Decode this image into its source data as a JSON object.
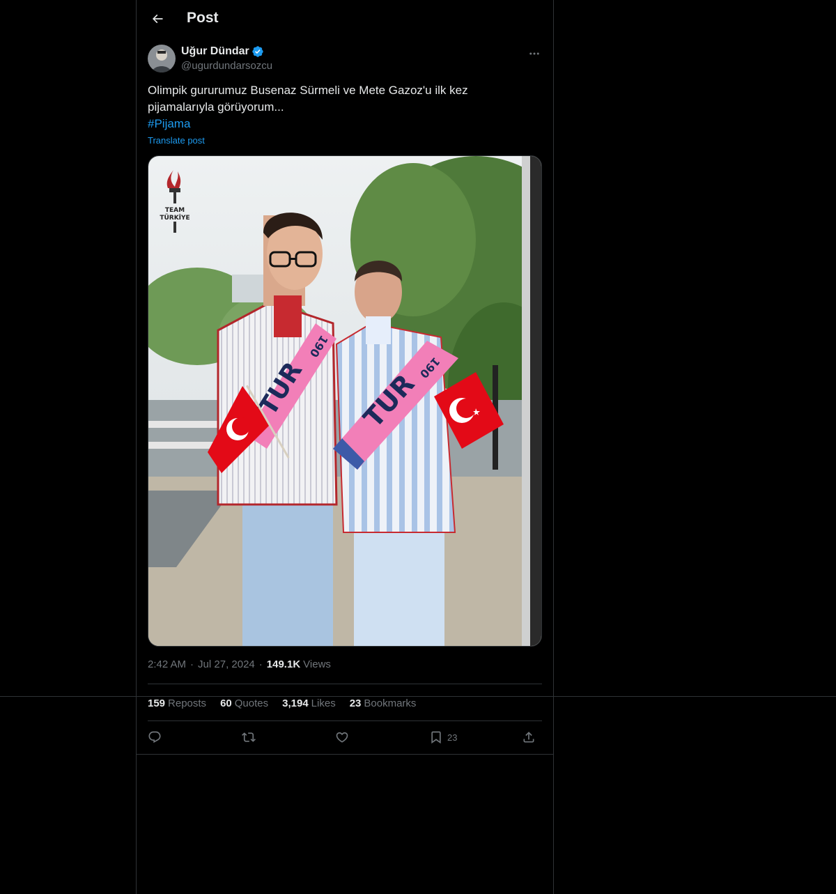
{
  "header": {
    "title": "Post",
    "back_icon": "arrow-left-icon"
  },
  "author": {
    "name": "Uğur Dündar",
    "handle": "@ugurdundarsozcu",
    "verified_icon": "verified-badge-icon",
    "verified_color": "#1d9bf0"
  },
  "post": {
    "text_line1": "Olimpik gururumuz Busenaz Sürmeli ve Mete Gazoz'u ilk kez",
    "text_line2": "pijamalarıyla görüyorum...",
    "hashtag": "#Pijama",
    "translate_label": "Translate post",
    "image_logo_text_1": "TEAM",
    "image_logo_text_2": "TÜRKİYE",
    "sash_text": "TUR",
    "sash_number": "190"
  },
  "meta": {
    "time": "2:42 AM",
    "date": "Jul 27, 2024",
    "views_count": "149.1K",
    "views_label": "Views"
  },
  "stats": {
    "reposts_count": "159",
    "reposts_label": "Reposts",
    "quotes_count": "60",
    "quotes_label": "Quotes",
    "likes_count": "3,194",
    "likes_label": "Likes",
    "bookmarks_count": "23",
    "bookmarks_label": "Bookmarks"
  },
  "actions": {
    "reply_icon": "reply-icon",
    "repost_icon": "repost-icon",
    "like_icon": "heart-icon",
    "bookmark_icon": "bookmark-icon",
    "bookmark_count": "23",
    "share_icon": "share-icon"
  },
  "colors": {
    "background": "#000000",
    "text_primary": "#e7e9ea",
    "text_secondary": "#71767b",
    "accent": "#1d9bf0",
    "border": "#2f3336"
  }
}
